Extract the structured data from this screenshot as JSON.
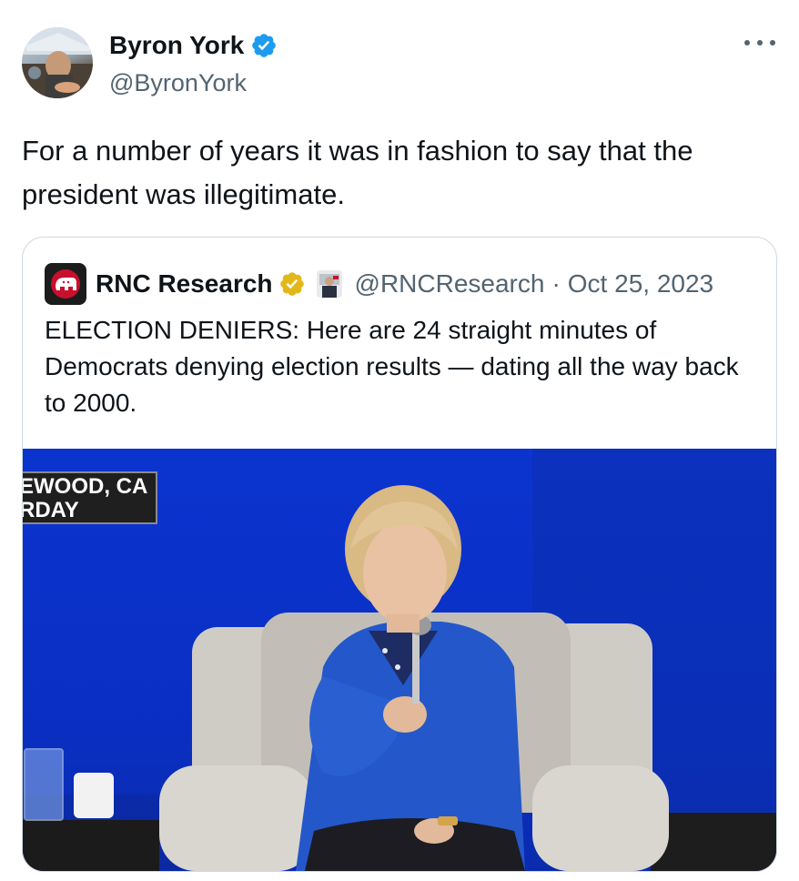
{
  "tweet": {
    "author": {
      "name": "Byron York",
      "handle": "@ByronYork",
      "verified_color": "#1d9bf0"
    },
    "more_icon": "more-horizontal-icon",
    "text": "For a number of years it was in fashion to say that the president was illegitimate."
  },
  "quoted_tweet": {
    "author": {
      "name": "RNC Research",
      "handle": "@RNCResearch",
      "separator": "·",
      "date": "Oct 25, 2023",
      "badge_color": "#e2b719",
      "logo_icon": "gop-elephant-icon",
      "affiliate_icon": "affiliate-avatar-icon"
    },
    "text": "ELECTION DENIERS: Here are 24 straight minutes of Democrats denying election results — dating all the way back to 2000.",
    "media": {
      "caption_line1": "EWOOD, CA",
      "caption_line2": "RDAY",
      "background_color": "#0b34cf"
    }
  }
}
